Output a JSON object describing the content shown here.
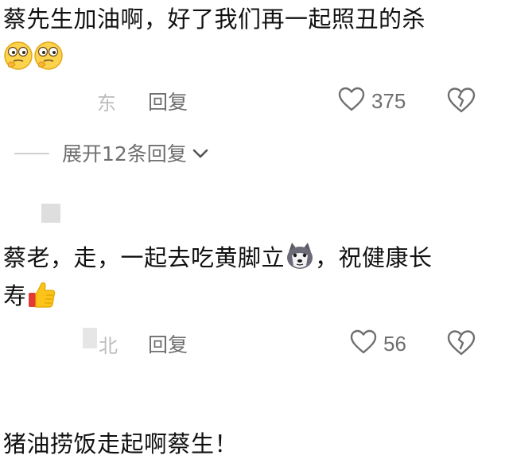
{
  "comments": [
    {
      "text": "蔡先生加油啊，好了我们再一起照丑的杀",
      "emojis": [
        "thinking-face-emoji",
        "thinking-face-emoji"
      ],
      "location": "东",
      "reply_label": "回复",
      "like_count": "375"
    },
    {
      "text_part1": "蔡老，走，一起去吃黄脚立",
      "text_part2": "，祝健康长",
      "text_part3": "寿",
      "emojis": [
        "husky-dog-emoji",
        "thumbs-up-emoji"
      ],
      "location": "北",
      "reply_label": "回复",
      "like_count": "56"
    },
    {
      "text": "猪油捞饭走起啊蔡生！"
    }
  ],
  "expand_replies": {
    "label": "展开12条回复"
  },
  "colors": {
    "text": "#111111",
    "meta": "#6f6f6f",
    "muted": "#bdbdbd",
    "background": "#ffffff"
  }
}
